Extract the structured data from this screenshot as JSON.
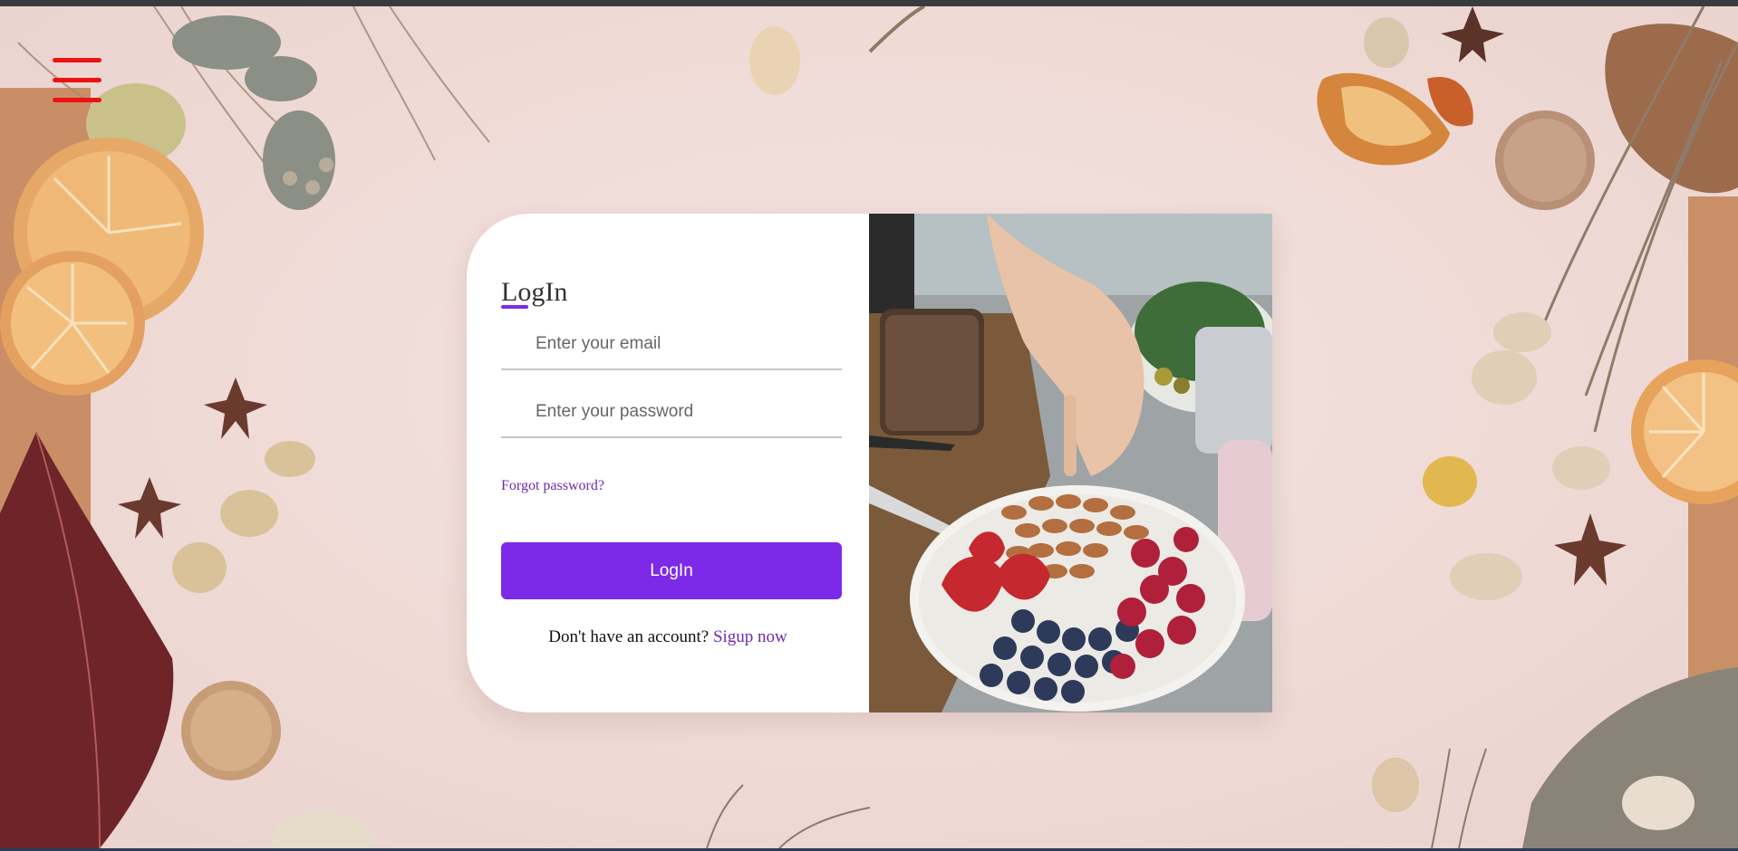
{
  "page": {
    "colors": {
      "accent": "#7d2ae8",
      "link": "#6c2bb0",
      "menu_icon": "#ee1111",
      "background": "#f1dcd8"
    }
  },
  "nav": {
    "menu_icon": "hamburger-menu-icon"
  },
  "login": {
    "title": "LogIn",
    "email_placeholder": "Enter your email",
    "password_placeholder": "Enter your password",
    "forgot_label": "Forgot password?",
    "submit_label": "LogIn",
    "signup_prompt": "Don't have an account?",
    "signup_link": "Sigup now"
  }
}
